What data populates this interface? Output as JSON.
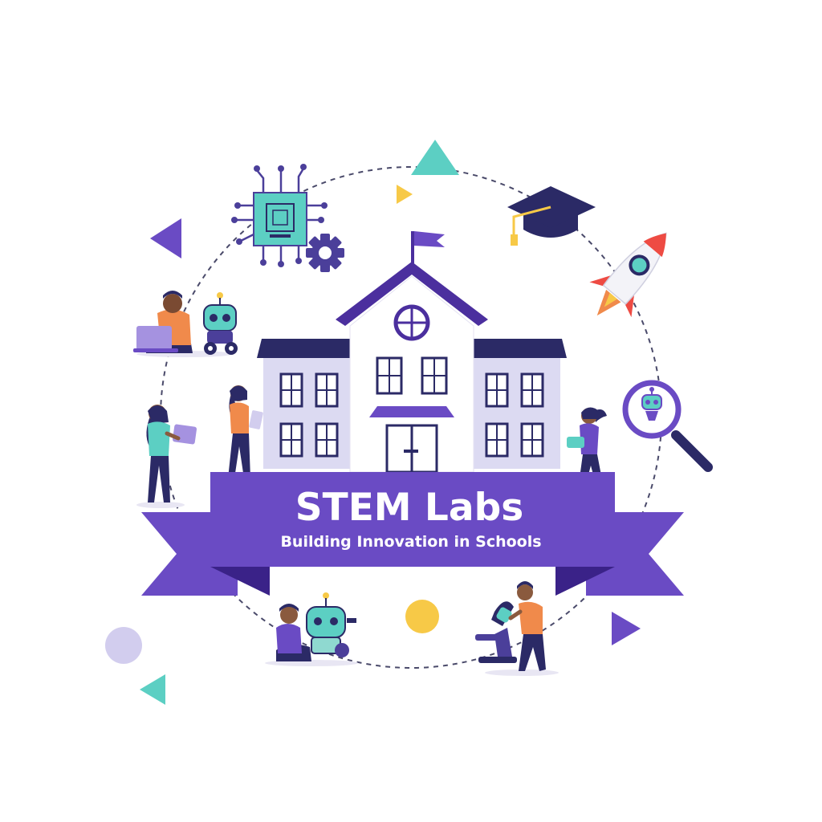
{
  "banner": {
    "title": "STEM Labs",
    "subtitle": "Building Innovation in Schools"
  },
  "colors": {
    "purple": "#6a4bc4",
    "purple_dark": "#4b2f9e",
    "navy": "#2b2a66",
    "teal": "#5ccfc3",
    "yellow": "#f7c947",
    "orange": "#f08a4b",
    "lavender": "#d2cdee",
    "red": "#ee4b43",
    "building_wall": "#dcdaf2",
    "building_center": "#ffffff"
  },
  "icons": [
    "circuit-chip-icon",
    "gear-icon",
    "graduation-cap-icon",
    "rocket-icon",
    "magnifying-glass-icon",
    "robot-icon",
    "microscope-icon",
    "laptop-icon",
    "school-flag-icon"
  ]
}
